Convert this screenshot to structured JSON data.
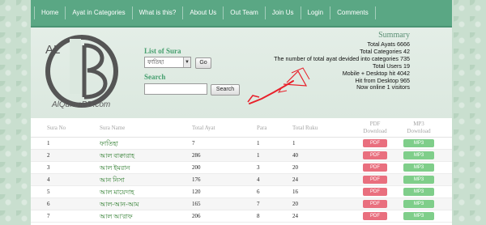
{
  "nav": {
    "items": [
      "Home",
      "Ayat in Categories",
      "What is this?",
      "About Us",
      "Out Team",
      "Join Us",
      "Login",
      "Comments"
    ]
  },
  "logo": {
    "text": "AlQuranBD.com",
    "letters": "AL B"
  },
  "list_sura": {
    "label": "List of Sura",
    "selected": "ফাতিহা",
    "go_label": "Go"
  },
  "search": {
    "label": "Search",
    "value": "",
    "button_label": "Search"
  },
  "summary": {
    "title": "Summary",
    "lines": [
      "Total Ayats 6666",
      "Total Categories 42",
      "The number of total ayat devided into categories 735",
      "Total Users 19",
      "Mobile + Desktop hit 4042",
      "Hit from Desktop 965",
      "Now online 1 visitors"
    ]
  },
  "table": {
    "headers": {
      "sura_no": "Sura No",
      "sura_name": "Sura Name",
      "total_ayat": "Total Ayat",
      "para": "Para",
      "total_ruku": "Total Ruku",
      "pdf": "PDF Download",
      "mp3": "MP3 Download"
    },
    "pdf_label": "PDF",
    "mp3_label": "MP3",
    "rows": [
      {
        "no": "1",
        "name": "ফাতিহা",
        "ayat": "7",
        "para": "1",
        "ruku": "1"
      },
      {
        "no": "2",
        "name": "আল বাক্বারাহ",
        "ayat": "286",
        "para": "1",
        "ruku": "40"
      },
      {
        "no": "3",
        "name": "আল ইমরান",
        "ayat": "200",
        "para": "3",
        "ruku": "20"
      },
      {
        "no": "4",
        "name": "আন নিসা",
        "ayat": "176",
        "para": "4",
        "ruku": "24"
      },
      {
        "no": "5",
        "name": "আল মায়েদাহ",
        "ayat": "120",
        "para": "6",
        "ruku": "16"
      },
      {
        "no": "6",
        "name": "আল-আন-আম",
        "ayat": "165",
        "para": "7",
        "ruku": "20"
      },
      {
        "no": "7",
        "name": "আল আ'রাফ",
        "ayat": "206",
        "para": "8",
        "ruku": "24"
      }
    ]
  },
  "colors": {
    "nav_bg": "#5aa784",
    "header_bg": "#dbe8df",
    "link_green": "#2f7d2f",
    "pdf_button": "#e96f7e",
    "mp3_button": "#7fce8a",
    "annotation": "#e8202a"
  }
}
